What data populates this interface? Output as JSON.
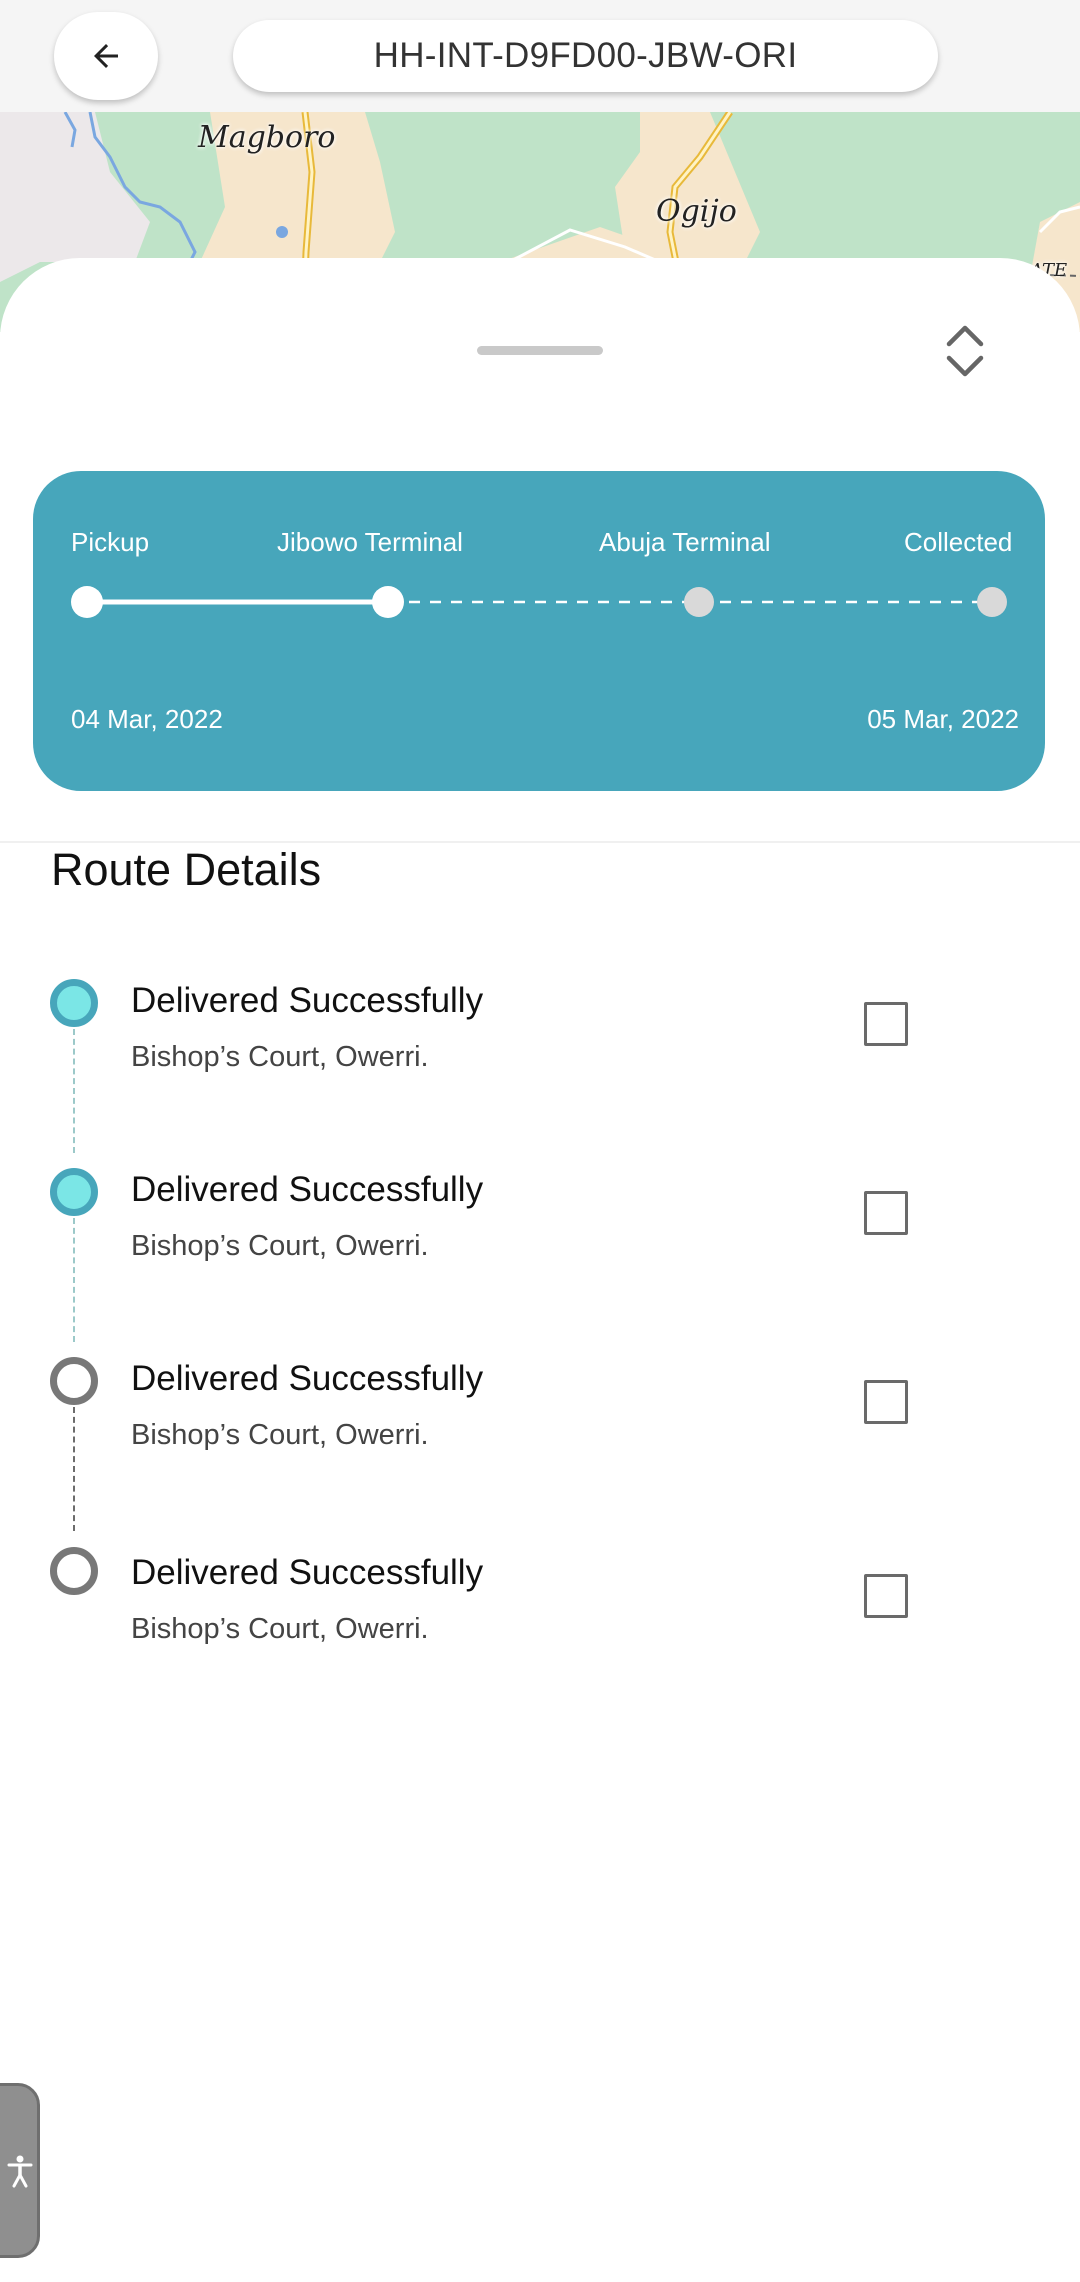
{
  "header": {
    "back_icon": "arrow-left-icon",
    "tracking_id": "HH-INT-D9FD00-JBW-ORI"
  },
  "map": {
    "labels": [
      "Magboro",
      "Ogijo",
      "ATE"
    ]
  },
  "sheet": {
    "expand_icon": "chevron-up-down-icon"
  },
  "progress": {
    "accent_color": "#47a6bb",
    "stages": [
      {
        "label": "Pickup",
        "completed": true
      },
      {
        "label": "Jibowo Terminal",
        "completed": true
      },
      {
        "label": "Abuja Terminal",
        "completed": false
      },
      {
        "label": "Collected",
        "completed": false
      }
    ],
    "start_date": "04 Mar, 2022",
    "end_date": "05 Mar, 2022"
  },
  "route": {
    "title": "Route Details",
    "items": [
      {
        "title": "Delivered Successfully",
        "address": "Bishop’s Court, Owerri.",
        "completed": true,
        "checked": false
      },
      {
        "title": "Delivered Successfully",
        "address": "Bishop’s Court, Owerri.",
        "completed": true,
        "checked": false
      },
      {
        "title": "Delivered Successfully",
        "address": "Bishop’s Court, Owerri.",
        "completed": false,
        "checked": false
      },
      {
        "title": "Delivered Successfully",
        "address": "Bishop’s Court, Owerri.",
        "completed": false,
        "checked": false
      }
    ]
  },
  "accessibility": {
    "icon": "accessibility-person-icon"
  }
}
